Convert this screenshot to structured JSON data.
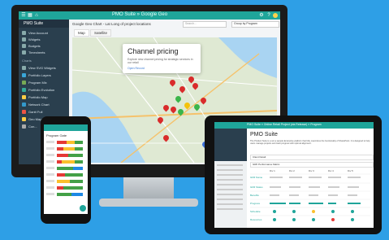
{
  "desktop": {
    "app_title": "PMO Suite » Google Geo",
    "sidebar": {
      "header": "PMO Suite",
      "items": [
        {
          "label": "View Account",
          "color": "#8aa"
        },
        {
          "label": "Widgets",
          "color": "#8aa"
        },
        {
          "label": "Budgets",
          "color": "#8aa"
        },
        {
          "label": "Timesheets",
          "color": "#8aa"
        },
        {
          "label": "Charts",
          "color": ""
        },
        {
          "label": "View SVG Widgets",
          "color": "#8aa"
        },
        {
          "label": "Portfolio Layers",
          "color": "#3aa6d8"
        },
        {
          "label": "Program Mix",
          "color": "#7a5"
        },
        {
          "label": "Portfolio Evolution",
          "color": "#3a9"
        },
        {
          "label": "Portfolio Map",
          "color": "#fc4"
        },
        {
          "label": "Network Chart",
          "color": "#39c"
        },
        {
          "label": "Gantt Full",
          "color": "#e54"
        },
        {
          "label": "Geo Map",
          "color": "#fc4"
        },
        {
          "label": "Con...",
          "color": "#aaa"
        }
      ]
    },
    "breadcrumb": "Google Geo Chart - Lat Long of project locations",
    "search_placeholder": "Search...",
    "group_label": "Group by Program",
    "tabs": [
      "Map",
      "Satellite"
    ],
    "popup": {
      "title": "Channel pricing",
      "desc": "Explore new channel pricing for strategic services in our retail",
      "link": "Open Record"
    }
  },
  "phone": {
    "title": "Program Gate",
    "rows": 9
  },
  "tablet": {
    "app_title": "PMO Suite » Online Retail Project (via Release) » Program",
    "page_title": "PMO Suite",
    "intro": "The Product Suite is a not a sample Enterprise platform that fully maximizes the functionality of SharePoint. It is designed to help users manage projects and track progress with optimal alignment.",
    "section_client": "Client Detail",
    "section_perf": "GRF Performance Matrix",
    "col_headers": [
      "Div 1",
      "Div 2",
      "Div 3",
      "Div 4",
      "Div 5"
    ],
    "row_labels": [
      "GFR Name",
      "GFR Status",
      "Benefits",
      "Progress",
      "Schedule",
      "Resources"
    ]
  }
}
